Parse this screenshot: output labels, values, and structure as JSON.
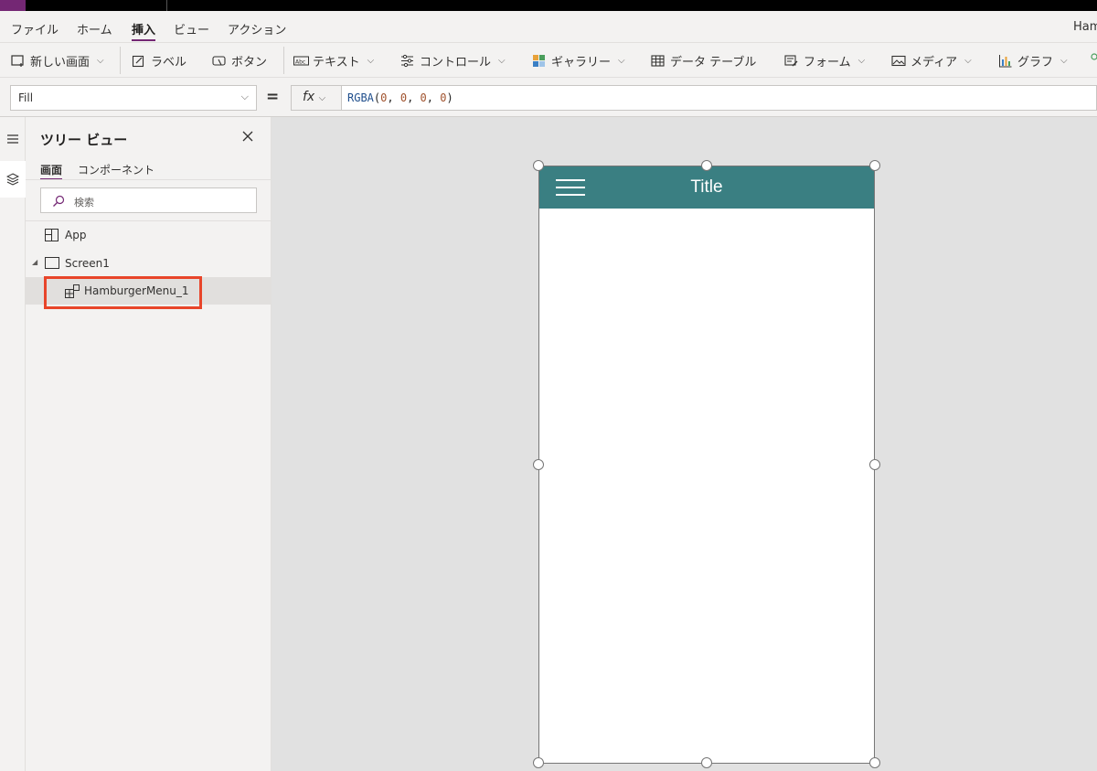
{
  "menubar": {
    "items": [
      "ファイル",
      "ホーム",
      "挿入",
      "ビュー",
      "アクション"
    ],
    "active": "挿入",
    "app_name": "Ham"
  },
  "ribbon": {
    "new_screen": "新しい画面",
    "label": "ラベル",
    "button": "ボタン",
    "text": "テキスト",
    "controls": "コントロール",
    "gallery": "ギャラリー",
    "data_table": "データ テーブル",
    "form": "フォーム",
    "media": "メディア",
    "chart": "グラフ"
  },
  "formula_bar": {
    "property": "Fill",
    "equals": "=",
    "fx": "fx",
    "formula_fn": "RGBA",
    "formula_args": [
      "0",
      "0",
      "0",
      "0"
    ]
  },
  "tree_view": {
    "title": "ツリー ビュー",
    "tabs": [
      "画面",
      "コンポーネント"
    ],
    "active_tab": "画面",
    "search_placeholder": "検索",
    "nodes": [
      {
        "label": "App"
      },
      {
        "label": "Screen1"
      },
      {
        "label": "HamburgerMenu_1"
      }
    ]
  },
  "canvas": {
    "header_title": "Title",
    "header_color": "#3a7f82"
  },
  "colors": {
    "accent": "#742774",
    "highlight": "#e8452a"
  }
}
